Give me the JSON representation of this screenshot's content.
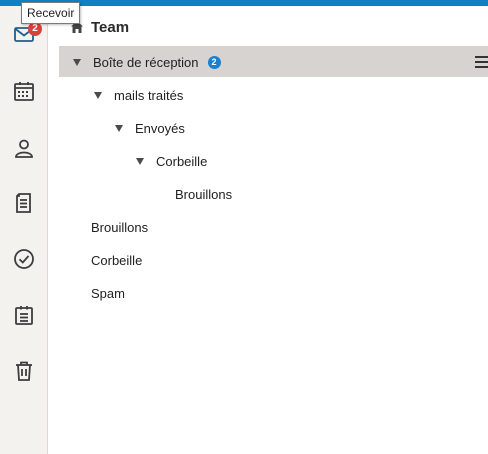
{
  "rail": {
    "inbox_badge": "2",
    "tooltip": "Recevoir",
    "icons": [
      "mail-icon",
      "calendar-icon",
      "contacts-icon",
      "notes-icon",
      "tasks-icon",
      "clipboard-icon",
      "trash-icon"
    ]
  },
  "header": {
    "title": "Team",
    "icon": "home-icon"
  },
  "folders": {
    "inbox": {
      "label": "Boîte de réception",
      "badge": "2"
    },
    "mails_traites": {
      "label": "mails traités"
    },
    "envoyes": {
      "label": "Envoyés"
    },
    "corbeille_nested": {
      "label": "Corbeille"
    },
    "brouillons_nested": {
      "label": "Brouillons"
    },
    "brouillons": {
      "label": "Brouillons"
    },
    "corbeille": {
      "label": "Corbeille"
    },
    "spam": {
      "label": "Spam"
    }
  },
  "colors": {
    "accent": "#0f7fc6",
    "rail_icon": "#1f5f8e",
    "selected_row": "#d6d3d0",
    "badge_red": "#d9413d",
    "badge_blue": "#1a7fd1"
  }
}
